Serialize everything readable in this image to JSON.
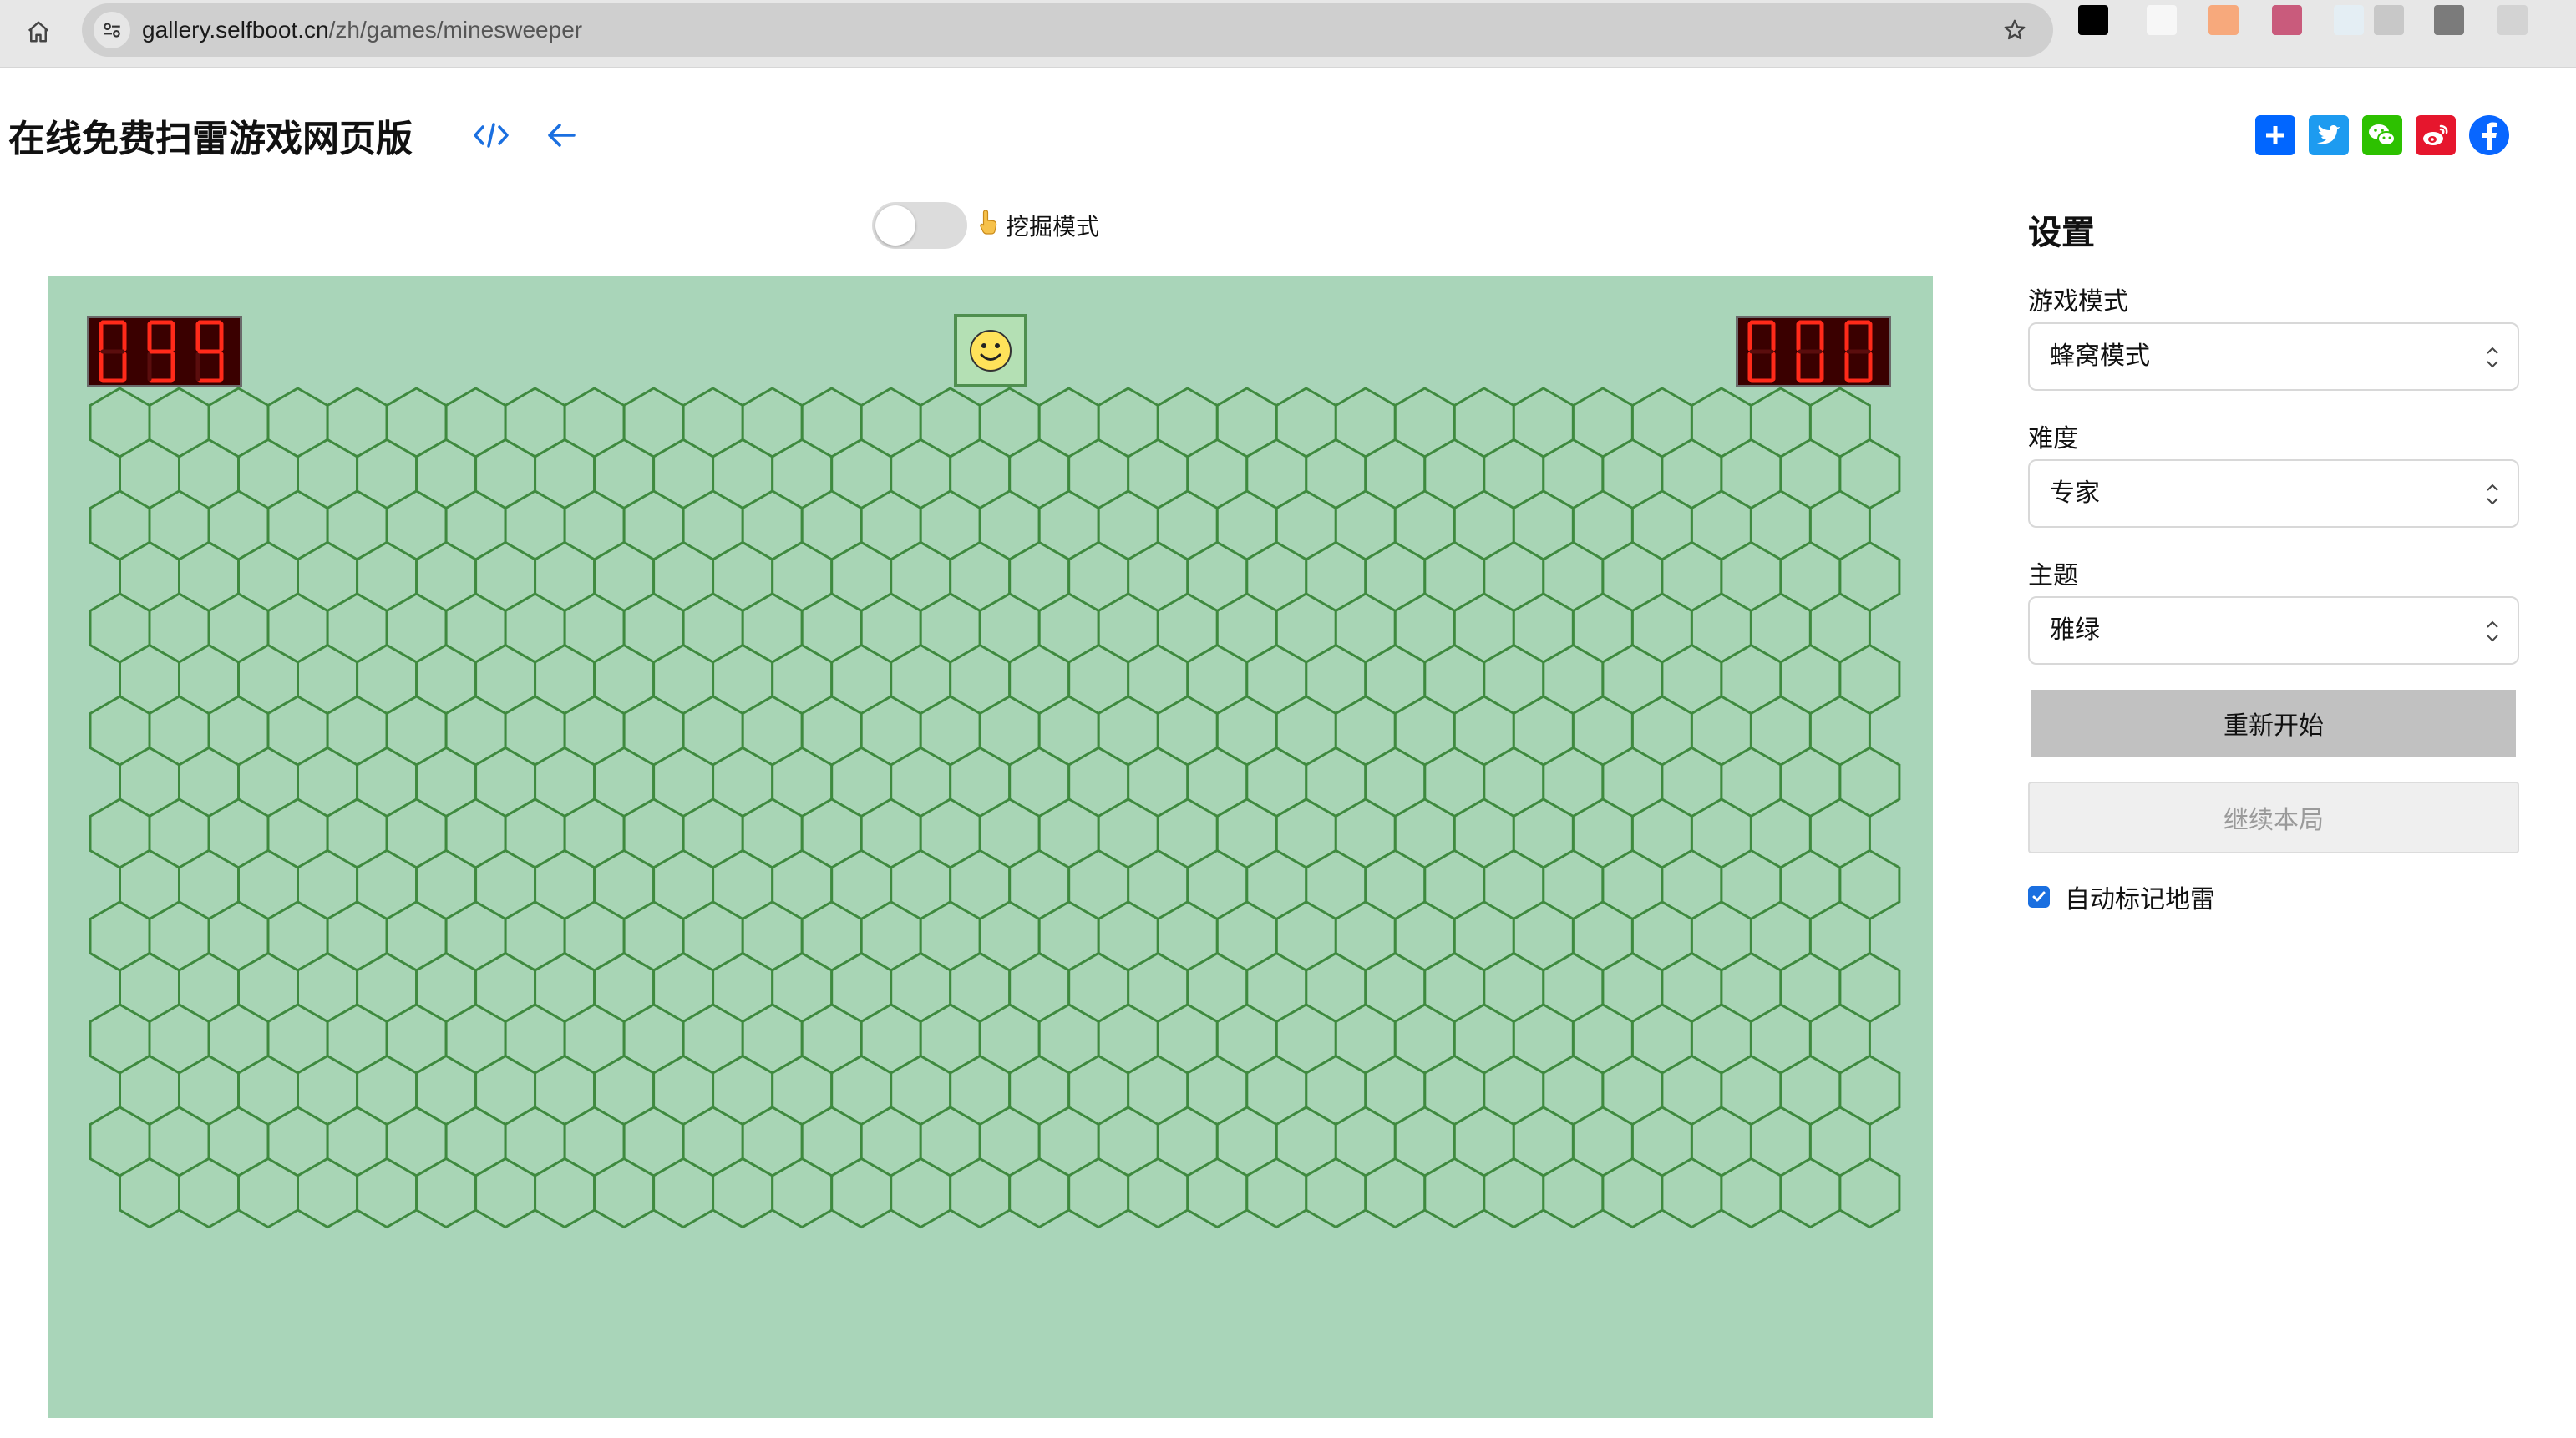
{
  "browser": {
    "url_host": "gallery.selfboot.cn",
    "url_path": "/zh/games/minesweeper",
    "extension_colors": [
      "#000000",
      "#f7f7f7",
      "#f7a97c",
      "#c95b7c",
      "#e4eef4",
      "#c8c8c8",
      "#7b7b7b",
      "#d3d3d3"
    ]
  },
  "page": {
    "title": "在线免费扫雷游戏网页版",
    "code_icon": "code-icon",
    "back_icon": "arrow-left-icon",
    "share": [
      {
        "name": "share-add-icon",
        "color": "#0166ff"
      },
      {
        "name": "twitter-icon",
        "color": "#1d9bf0"
      },
      {
        "name": "wechat-icon",
        "color": "#2dc100"
      },
      {
        "name": "weibo-icon",
        "color": "#e6162d"
      },
      {
        "name": "facebook-icon",
        "color": "#0866ff"
      }
    ]
  },
  "toolbar": {
    "dig_mode_label": "挖掘模式",
    "dig_mode_on": false
  },
  "game": {
    "mines_left": "099",
    "timer": "000",
    "face": "smiley",
    "board_color": "#a9d5b9",
    "cell_rows": 16,
    "cell_cols": 30,
    "cell_fill": "#a8d5b5",
    "cell_edge": "#3f8a3f"
  },
  "settings": {
    "title": "设置",
    "mode_label": "游戏模式",
    "mode_value": "蜂窝模式",
    "difficulty_label": "难度",
    "difficulty_value": "专家",
    "theme_label": "主题",
    "theme_value": "雅绿",
    "restart_label": "重新开始",
    "continue_label": "继续本局",
    "auto_flag_label": "自动标记地雷",
    "auto_flag_checked": true
  }
}
